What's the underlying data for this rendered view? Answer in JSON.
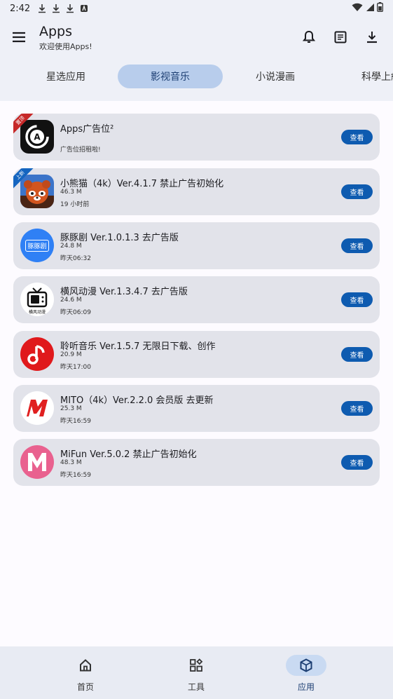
{
  "status_bar": {
    "time": "2:42"
  },
  "app_bar": {
    "title": "Apps",
    "subtitle": "欢迎使用Apps!"
  },
  "tabs": [
    {
      "label": "星选应用"
    },
    {
      "label": "影视音乐",
      "active": true
    },
    {
      "label": "小说漫画"
    },
    {
      "label": "科學上網"
    }
  ],
  "apps": [
    {
      "title": "Apps广告位²",
      "subtitle": "广告位招租啦!",
      "button": "查看",
      "ribbon": "置顶",
      "ribbon_color": "#c62828"
    },
    {
      "title": "小熊猫（4k）Ver.4.1.7 禁止广告初始化",
      "size": "46.3 M",
      "time": "19 小时前",
      "button": "查看",
      "ribbon": "上新",
      "ribbon_color": "#1565c0"
    },
    {
      "title": "豚豚剧 Ver.1.0.1.3 去广告版",
      "size": "24.8 M",
      "time": "昨天06:32",
      "button": "查看",
      "icon_text": "豚豚剧"
    },
    {
      "title": "横风动漫 Ver.1.3.4.7 去广告版",
      "size": "24.6 M",
      "time": "昨天06:09",
      "button": "查看",
      "icon_text": "横风动漫"
    },
    {
      "title": "聆听音乐 Ver.1.5.7 无限日下载、创作",
      "size": "20.9 M",
      "time": "昨天17:00",
      "button": "查看"
    },
    {
      "title": "MITO（4k）Ver.2.2.0 会员版 去更新",
      "size": "25.3 M",
      "time": "昨天16:59",
      "button": "查看"
    },
    {
      "title": "MiFun Ver.5.0.2 禁止广告初始化",
      "size": "48.3 M",
      "time": "昨天16:59",
      "button": "查看"
    }
  ],
  "bottom_nav": [
    {
      "label": "首页",
      "icon": "home-icon"
    },
    {
      "label": "工具",
      "icon": "grid-icon"
    },
    {
      "label": "应用",
      "icon": "cube-icon",
      "active": true
    }
  ],
  "colors": {
    "accent": "#0e5bb0",
    "tab_active": "#b8cdec",
    "card": "#e2e3ea"
  }
}
